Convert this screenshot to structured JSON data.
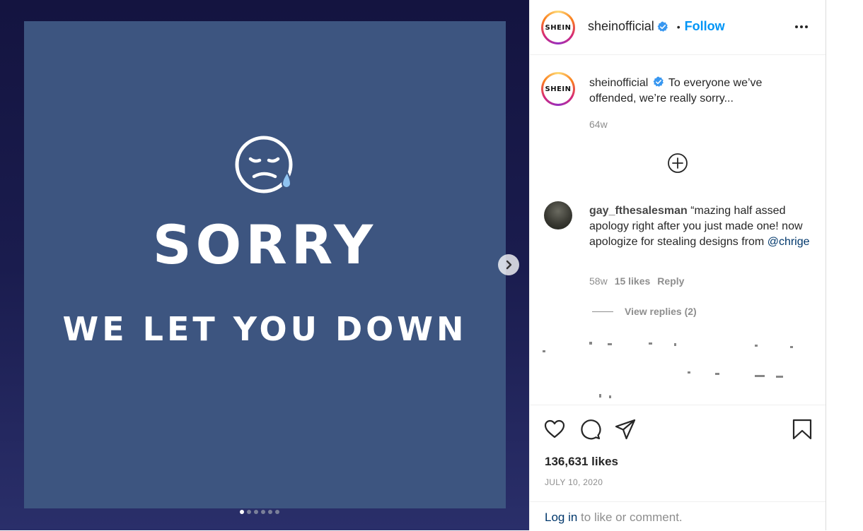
{
  "post": {
    "slide_title": "SORRY",
    "slide_subtitle": "WE LET YOU DOWN",
    "slide_count": 6,
    "active_slide": 1
  },
  "header": {
    "avatar_text": "SHEIN",
    "username": "sheinofficial",
    "separator": "•",
    "follow_label": "Follow"
  },
  "caption": {
    "avatar_text": "SHEIN",
    "username": "sheinofficial",
    "text": "To everyone we’ve offended, we’re really sorry...",
    "time": "64w"
  },
  "comment": {
    "username": "gay_fthesalesman",
    "text_before": "“mazing half assed apology right after you just made one! now apologize for stealing designs from ",
    "mention": "@chrige",
    "time": "58w",
    "likes": "15 likes",
    "reply_label": "Reply",
    "view_replies": "View replies (2)"
  },
  "footer": {
    "likes": "136,631 likes",
    "date": "JULY 10, 2020",
    "login_link": "Log in",
    "login_rest": " to like or comment."
  },
  "colors": {
    "slide_bg": "#3d5580",
    "accent": "#0095f6",
    "verified": "#3897f0"
  },
  "icons": [
    "sad-face-emoji-icon",
    "chevron-right-icon",
    "verified-badge-icon",
    "more-options-icon",
    "plus-circle-icon",
    "heart-icon",
    "comment-icon",
    "share-icon",
    "bookmark-icon"
  ]
}
